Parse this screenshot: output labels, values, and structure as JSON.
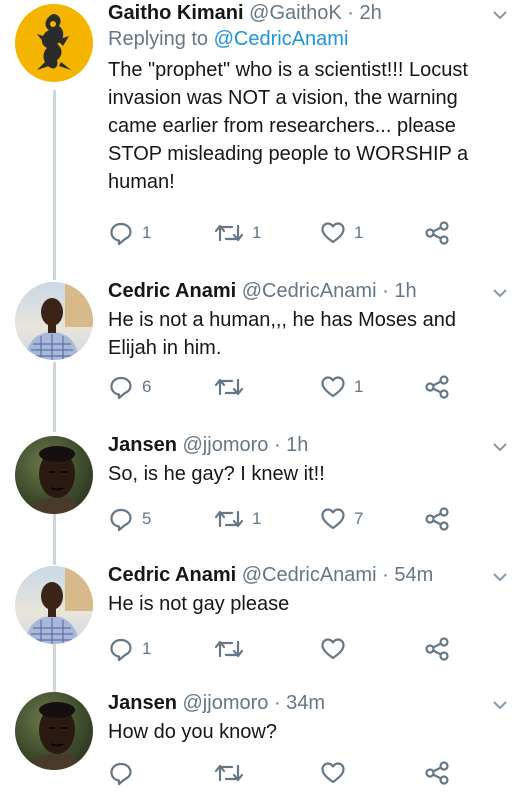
{
  "tweets": [
    {
      "name": "Gaitho Kimani",
      "handle": "@GaithoK",
      "time": "2h",
      "replying_prefix": "Replying to",
      "replying_to": "@CedricAnami",
      "text_lines": [
        "The \"prophet\" who is a scientist!!! Locust",
        "invasion was NOT a vision, the warning",
        "came earlier from researchers... please",
        "STOP misleading people to WORSHIP a",
        "human!"
      ],
      "replies": "1",
      "retweets": "1",
      "likes": "1"
    },
    {
      "name": "Cedric Anami",
      "handle": "@CedricAnami",
      "time": "1h",
      "text_lines": [
        "He is not a human,,, he has Moses and",
        "Elijah in him."
      ],
      "replies": "6",
      "retweets": "",
      "likes": "1"
    },
    {
      "name": "Jansen",
      "handle": "@jjomoro",
      "time": "1h",
      "text_lines": [
        "So, is he gay? I knew it!!"
      ],
      "replies": "5",
      "retweets": "1",
      "likes": "7"
    },
    {
      "name": "Cedric Anami",
      "handle": "@CedricAnami",
      "time": "54m",
      "text_lines": [
        "He is not gay please"
      ],
      "replies": "1",
      "retweets": "",
      "likes": ""
    },
    {
      "name": "Jansen",
      "handle": "@jjomoro",
      "time": "34m",
      "text_lines": [
        "How do you know?"
      ],
      "replies": "",
      "retweets": "",
      "likes": ""
    }
  ],
  "separator": " · ",
  "icons": {
    "reply": "reply-icon",
    "retweet": "retweet-icon",
    "like": "heart-icon",
    "share": "share-icon",
    "caret": "chevron-down-icon"
  },
  "colors": {
    "name": "#14171a",
    "muted": "#657786",
    "link": "#1b95e0",
    "thread_line": "#ccd6dd"
  }
}
